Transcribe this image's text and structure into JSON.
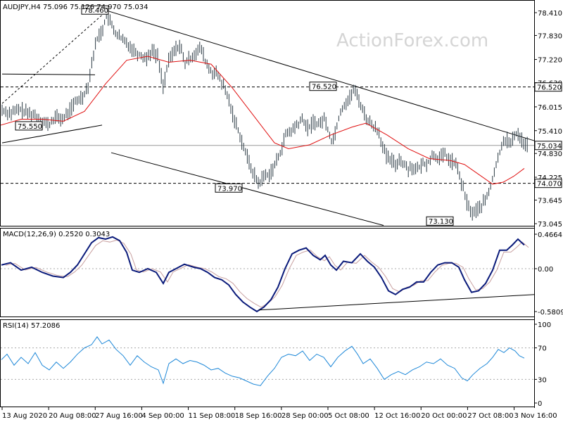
{
  "chart_data": {
    "type": "candlestick",
    "symbol_line": "AUDJPY,H4  75.096 75.126 74.970 75.034",
    "watermark": "ActionForex.com",
    "x_labels": [
      "13 Aug 2020",
      "20 Aug 08:00",
      "27 Aug 16:00",
      "4 Sep 00:00",
      "11 Sep 08:00",
      "18 Sep 16:00",
      "28 Sep 00:00",
      "5 Oct 08:00",
      "12 Oct 16:00",
      "20 Oct 00:00",
      "27 Oct 08:00",
      "3 Nov 16:00"
    ],
    "price_panel": {
      "y_ticks": [
        "78.410",
        "77.830",
        "77.220",
        "76.630",
        "76.015",
        "75.410",
        "74.830",
        "74.225",
        "73.645",
        "73.045"
      ],
      "ylim": [
        73.045,
        78.41
      ],
      "current_price": "75.034",
      "levels": [
        {
          "label": "76.520",
          "value": 76.52
        },
        {
          "label": "74.070",
          "value": 74.07
        }
      ],
      "annotations": [
        {
          "text": "78.460",
          "x": 152
        },
        {
          "text": "75.550",
          "x": 58
        },
        {
          "text": "73.970",
          "x": 342
        },
        {
          "text": "76.520",
          "x": 476
        },
        {
          "text": "73.130",
          "x": 642
        }
      ],
      "close_path": [
        [
          1,
          75.95
        ],
        [
          15,
          75.85
        ],
        [
          28,
          75.95
        ],
        [
          40,
          75.85
        ],
        [
          50,
          75.8
        ],
        [
          60,
          75.65
        ],
        [
          70,
          75.55
        ],
        [
          78,
          75.75
        ],
        [
          90,
          75.7
        ],
        [
          100,
          75.95
        ],
        [
          108,
          76.15
        ],
        [
          118,
          76.3
        ],
        [
          125,
          76.55
        ],
        [
          132,
          77.3
        ],
        [
          138,
          77.75
        ],
        [
          145,
          77.95
        ],
        [
          152,
          78.35
        ],
        [
          158,
          78.1
        ],
        [
          166,
          77.85
        ],
        [
          175,
          77.7
        ],
        [
          183,
          77.6
        ],
        [
          190,
          77.45
        ],
        [
          198,
          77.35
        ],
        [
          208,
          77.25
        ],
        [
          216,
          77.45
        ],
        [
          224,
          77.3
        ],
        [
          232,
          76.55
        ],
        [
          240,
          77.2
        ],
        [
          248,
          77.45
        ],
        [
          256,
          77.6
        ],
        [
          262,
          77.1
        ],
        [
          270,
          77.25
        ],
        [
          278,
          77.4
        ],
        [
          286,
          77.5
        ],
        [
          292,
          77.15
        ],
        [
          300,
          76.9
        ],
        [
          308,
          76.85
        ],
        [
          316,
          76.6
        ],
        [
          324,
          76.25
        ],
        [
          332,
          75.75
        ],
        [
          340,
          75.35
        ],
        [
          348,
          74.9
        ],
        [
          355,
          74.55
        ],
        [
          362,
          74.25
        ],
        [
          368,
          74.05
        ],
        [
          374,
          74.25
        ],
        [
          382,
          74.3
        ],
        [
          390,
          74.5
        ],
        [
          398,
          74.85
        ],
        [
          406,
          75.3
        ],
        [
          414,
          75.4
        ],
        [
          422,
          75.55
        ],
        [
          430,
          75.7
        ],
        [
          438,
          75.45
        ],
        [
          446,
          75.65
        ],
        [
          454,
          75.55
        ],
        [
          460,
          75.75
        ],
        [
          466,
          75.45
        ],
        [
          472,
          75.1
        ],
        [
          478,
          75.5
        ],
        [
          484,
          75.9
        ],
        [
          490,
          76.1
        ],
        [
          496,
          76.2
        ],
        [
          502,
          76.45
        ],
        [
          508,
          76.3
        ],
        [
          514,
          76.0
        ],
        [
          520,
          75.75
        ],
        [
          526,
          75.6
        ],
        [
          532,
          75.5
        ],
        [
          538,
          75.4
        ],
        [
          544,
          75.0
        ],
        [
          550,
          74.7
        ],
        [
          556,
          74.65
        ],
        [
          562,
          74.55
        ],
        [
          568,
          74.7
        ],
        [
          574,
          74.55
        ],
        [
          580,
          74.45
        ],
        [
          586,
          74.5
        ],
        [
          592,
          74.4
        ],
        [
          600,
          74.55
        ],
        [
          608,
          74.6
        ],
        [
          616,
          74.8
        ],
        [
          624,
          74.7
        ],
        [
          632,
          74.8
        ],
        [
          640,
          74.65
        ],
        [
          648,
          74.55
        ],
        [
          654,
          74.2
        ],
        [
          660,
          73.8
        ],
        [
          666,
          73.45
        ],
        [
          672,
          73.3
        ],
        [
          678,
          73.4
        ],
        [
          684,
          73.5
        ],
        [
          690,
          73.65
        ],
        [
          696,
          73.9
        ],
        [
          702,
          74.35
        ],
        [
          708,
          74.7
        ],
        [
          714,
          75.15
        ],
        [
          720,
          75.2
        ],
        [
          726,
          75.05
        ],
        [
          732,
          75.35
        ],
        [
          738,
          75.3
        ],
        [
          744,
          75.1
        ],
        [
          750,
          75.03
        ]
      ],
      "ma_path": [
        [
          1,
          75.55
        ],
        [
          30,
          75.7
        ],
        [
          60,
          75.7
        ],
        [
          90,
          75.65
        ],
        [
          120,
          75.9
        ],
        [
          150,
          76.6
        ],
        [
          180,
          77.2
        ],
        [
          210,
          77.3
        ],
        [
          240,
          77.15
        ],
        [
          270,
          77.2
        ],
        [
          300,
          77.1
        ],
        [
          330,
          76.5
        ],
        [
          360,
          75.8
        ],
        [
          390,
          75.1
        ],
        [
          410,
          74.95
        ],
        [
          440,
          75.05
        ],
        [
          470,
          75.3
        ],
        [
          500,
          75.5
        ],
        [
          520,
          75.6
        ],
        [
          550,
          75.3
        ],
        [
          580,
          74.95
        ],
        [
          610,
          74.7
        ],
        [
          640,
          74.65
        ],
        [
          660,
          74.55
        ],
        [
          680,
          74.3
        ],
        [
          700,
          74.05
        ],
        [
          715,
          74.1
        ],
        [
          730,
          74.25
        ],
        [
          745,
          74.45
        ]
      ],
      "trendlines": [
        {
          "from": [
            152,
            78.46
          ],
          "to": [
            760,
            75.15
          ]
        },
        {
          "from": [
            158,
            74.85
          ],
          "to": [
            545,
            73.0
          ]
        },
        {
          "from": [
            3,
            75.1
          ],
          "to": [
            145,
            75.55
          ]
        },
        {
          "from": [
            3,
            76.85
          ],
          "to": [
            135,
            76.83
          ]
        }
      ],
      "dashed_line": {
        "from": [
          3,
          76.1
        ],
        "to": [
          152,
          78.46
        ]
      }
    },
    "macd_panel": {
      "title": "MACD(12,26,9) 0.2520 0.3043",
      "y_ticks": [
        "0.4664",
        "0.00",
        "-0.5809"
      ],
      "ylim": [
        -0.5809,
        0.4664
      ],
      "macd_path": [
        [
          2,
          0.05
        ],
        [
          15,
          0.08
        ],
        [
          30,
          -0.02
        ],
        [
          45,
          0.02
        ],
        [
          60,
          -0.05
        ],
        [
          75,
          -0.1
        ],
        [
          90,
          -0.12
        ],
        [
          100,
          -0.05
        ],
        [
          110,
          0.05
        ],
        [
          120,
          0.2
        ],
        [
          130,
          0.35
        ],
        [
          140,
          0.42
        ],
        [
          150,
          0.4
        ],
        [
          160,
          0.43
        ],
        [
          170,
          0.38
        ],
        [
          180,
          0.22
        ],
        [
          188,
          -0.02
        ],
        [
          198,
          -0.05
        ],
        [
          210,
          0.0
        ],
        [
          222,
          -0.05
        ],
        [
          232,
          -0.2
        ],
        [
          240,
          -0.05
        ],
        [
          250,
          0.0
        ],
        [
          262,
          0.06
        ],
        [
          275,
          0.02
        ],
        [
          285,
          0.0
        ],
        [
          295,
          -0.05
        ],
        [
          305,
          -0.12
        ],
        [
          315,
          -0.15
        ],
        [
          325,
          -0.22
        ],
        [
          335,
          -0.35
        ],
        [
          345,
          -0.45
        ],
        [
          355,
          -0.52
        ],
        [
          365,
          -0.58
        ],
        [
          375,
          -0.52
        ],
        [
          385,
          -0.42
        ],
        [
          395,
          -0.25
        ],
        [
          405,
          0.0
        ],
        [
          415,
          0.2
        ],
        [
          425,
          0.25
        ],
        [
          435,
          0.28
        ],
        [
          445,
          0.18
        ],
        [
          455,
          0.12
        ],
        [
          462,
          0.18
        ],
        [
          470,
          0.05
        ],
        [
          478,
          -0.02
        ],
        [
          488,
          0.1
        ],
        [
          500,
          0.08
        ],
        [
          512,
          0.2
        ],
        [
          522,
          0.1
        ],
        [
          532,
          0.02
        ],
        [
          542,
          -0.12
        ],
        [
          552,
          -0.3
        ],
        [
          562,
          -0.35
        ],
        [
          572,
          -0.28
        ],
        [
          582,
          -0.25
        ],
        [
          592,
          -0.18
        ],
        [
          602,
          -0.18
        ],
        [
          612,
          -0.05
        ],
        [
          622,
          0.05
        ],
        [
          632,
          0.08
        ],
        [
          642,
          0.08
        ],
        [
          652,
          0.02
        ],
        [
          660,
          -0.15
        ],
        [
          670,
          -0.32
        ],
        [
          680,
          -0.3
        ],
        [
          690,
          -0.2
        ],
        [
          700,
          -0.02
        ],
        [
          710,
          0.25
        ],
        [
          720,
          0.25
        ],
        [
          728,
          0.32
        ],
        [
          736,
          0.4
        ],
        [
          745,
          0.32
        ]
      ],
      "trendline": {
        "from": [
          368,
          -0.56
        ],
        "to": [
          760,
          -0.35
        ]
      }
    },
    "rsi_panel": {
      "title": "RSI(14) 57.2086",
      "y_ticks": [
        "100",
        "70",
        "30",
        "0"
      ],
      "ylim": [
        0,
        100
      ],
      "levels": [
        70,
        30
      ],
      "rsi_path": [
        [
          2,
          55
        ],
        [
          10,
          62
        ],
        [
          20,
          48
        ],
        [
          30,
          58
        ],
        [
          40,
          50
        ],
        [
          50,
          64
        ],
        [
          60,
          48
        ],
        [
          70,
          42
        ],
        [
          80,
          52
        ],
        [
          90,
          44
        ],
        [
          100,
          52
        ],
        [
          110,
          62
        ],
        [
          120,
          70
        ],
        [
          130,
          74
        ],
        [
          138,
          84
        ],
        [
          145,
          75
        ],
        [
          155,
          80
        ],
        [
          165,
          68
        ],
        [
          175,
          60
        ],
        [
          185,
          48
        ],
        [
          195,
          60
        ],
        [
          205,
          52
        ],
        [
          215,
          46
        ],
        [
          225,
          42
        ],
        [
          232,
          25
        ],
        [
          240,
          50
        ],
        [
          250,
          56
        ],
        [
          260,
          50
        ],
        [
          270,
          54
        ],
        [
          280,
          52
        ],
        [
          290,
          48
        ],
        [
          300,
          42
        ],
        [
          310,
          44
        ],
        [
          320,
          38
        ],
        [
          330,
          34
        ],
        [
          340,
          32
        ],
        [
          350,
          28
        ],
        [
          360,
          24
        ],
        [
          370,
          22
        ],
        [
          380,
          34
        ],
        [
          390,
          44
        ],
        [
          400,
          58
        ],
        [
          410,
          62
        ],
        [
          420,
          60
        ],
        [
          430,
          66
        ],
        [
          440,
          54
        ],
        [
          450,
          62
        ],
        [
          460,
          58
        ],
        [
          470,
          46
        ],
        [
          480,
          58
        ],
        [
          490,
          66
        ],
        [
          500,
          72
        ],
        [
          508,
          62
        ],
        [
          516,
          50
        ],
        [
          526,
          56
        ],
        [
          536,
          44
        ],
        [
          546,
          30
        ],
        [
          556,
          36
        ],
        [
          566,
          40
        ],
        [
          576,
          36
        ],
        [
          586,
          42
        ],
        [
          596,
          46
        ],
        [
          606,
          52
        ],
        [
          616,
          50
        ],
        [
          626,
          56
        ],
        [
          636,
          48
        ],
        [
          646,
          44
        ],
        [
          656,
          32
        ],
        [
          664,
          28
        ],
        [
          672,
          36
        ],
        [
          682,
          44
        ],
        [
          692,
          50
        ],
        [
          700,
          58
        ],
        [
          708,
          68
        ],
        [
          716,
          64
        ],
        [
          724,
          70
        ],
        [
          732,
          66
        ],
        [
          738,
          60
        ],
        [
          745,
          57
        ]
      ]
    }
  }
}
